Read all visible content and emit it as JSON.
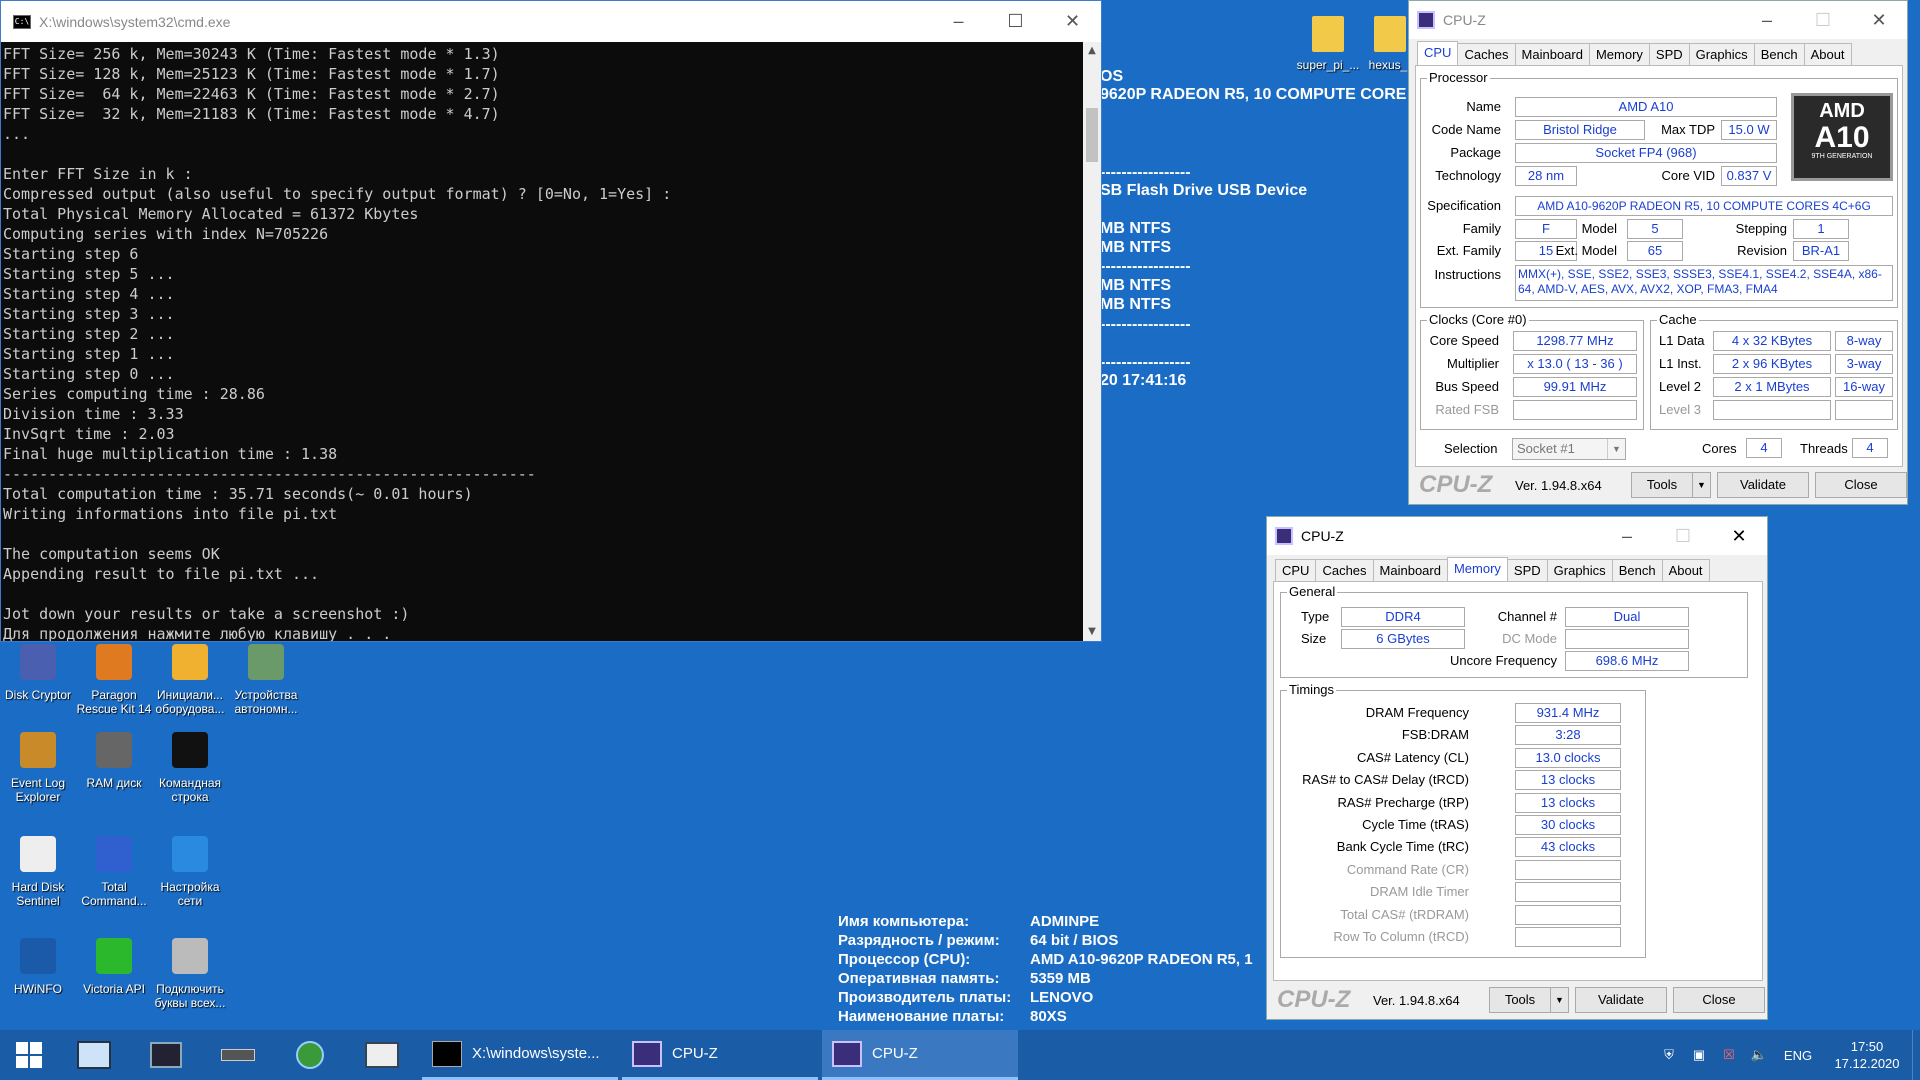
{
  "cmd": {
    "title": "X:\\windows\\system32\\cmd.exe",
    "icon": "cmd-icon",
    "lines": [
      "FFT Size= 256 k, Mem=30243 K (Time: Fastest mode * 1.3)",
      "FFT Size= 128 k, Mem=25123 K (Time: Fastest mode * 1.7)",
      "FFT Size=  64 k, Mem=22463 K (Time: Fastest mode * 2.7)",
      "FFT Size=  32 k, Mem=21183 K (Time: Fastest mode * 4.7)",
      "...",
      "",
      "Enter FFT Size in k :",
      "Compressed output (also useful to specify output format) ? [0=No, 1=Yes] :",
      "Total Physical Memory Allocated = 61372 Kbytes",
      "Computing series with index N=705226",
      "Starting step 6",
      "Starting step 5 ...",
      "Starting step 4 ...",
      "Starting step 3 ...",
      "Starting step 2 ...",
      "Starting step 1 ...",
      "Starting step 0 ...",
      "Series computing time : 28.86",
      "Division time : 3.33",
      "InvSqrt time : 2.03",
      "Final huge multiplication time : 1.38",
      "-----------------------------------------------------------",
      "Total computation time : 35.71 seconds(~ 0.01 hours)",
      "Writing informations into file pi.txt",
      "",
      "The computation seems OK",
      "Appending result to file pi.txt ...",
      "",
      "Jot down your results or take a screenshot :)",
      "Для продолжения нажмите любую клавишу . . ."
    ]
  },
  "bg": {
    "line1": "OS",
    "line2": "9620P RADEON R5, 10 COMPUTE CORE",
    "sep": "-----------------",
    "usb": "SB Flash Drive USB Device",
    "ntfs1": "MB NTFS",
    "ntfs2": "MB NTFS",
    "ntfs3": "MB NTFS",
    "ntfs4": "MB NTFS",
    "date": "20 17:41:16"
  },
  "sysinfo": {
    "labels": [
      "Имя компьютера:",
      "Разрядность / режим:",
      "Процессор (CPU):",
      "Оперативная память:",
      "Производитель платы:",
      "Наименование платы:"
    ],
    "values": [
      "ADMINPE",
      "64 bit / BIOS",
      "AMD A10-9620P RADEON R5, 1",
      "5359 MB",
      "LENOVO",
      "80XS"
    ]
  },
  "desktop": {
    "top_icons": [
      {
        "label": "super_pi_...",
        "icon": "folder-icon"
      },
      {
        "label": "hexus_",
        "icon": "folder-icon"
      }
    ],
    "icons": [
      {
        "label": "Disk Cryptor",
        "icon": "diskcryptor-icon"
      },
      {
        "label": "Paragon Rescue Kit 14",
        "icon": "paragon-icon"
      },
      {
        "label": "Инициали... оборудова...",
        "icon": "hardware-init-icon"
      },
      {
        "label": "Устройства автономн...",
        "icon": "offline-devices-icon"
      },
      {
        "label": "Event Log Explorer",
        "icon": "event-log-icon"
      },
      {
        "label": "RAM диск",
        "icon": "ram-disk-icon"
      },
      {
        "label": "Командная строка",
        "icon": "cmd-icon"
      },
      {
        "label": "Hard Disk Sentinel",
        "icon": "hdd-sentinel-icon"
      },
      {
        "label": "Total Command...",
        "icon": "total-commander-icon"
      },
      {
        "label": "Настройка сети",
        "icon": "network-settings-icon"
      },
      {
        "label": "HWiNFO",
        "icon": "hwinfo-icon"
      },
      {
        "label": "Victoria API",
        "icon": "victoria-icon"
      },
      {
        "label": "Подключить буквы всех...",
        "icon": "connect-drives-icon"
      }
    ]
  },
  "cpuz1": {
    "title": "CPU-Z",
    "tabs": [
      "CPU",
      "Caches",
      "Mainboard",
      "Memory",
      "SPD",
      "Graphics",
      "Bench",
      "About"
    ],
    "active": "CPU",
    "processor_label": "Processor",
    "name_label": "Name",
    "name": "AMD A10",
    "codename_label": "Code Name",
    "codename": "Bristol Ridge",
    "tdp_label": "Max TDP",
    "tdp": "15.0 W",
    "package_label": "Package",
    "package": "Socket FP4 (968)",
    "tech_label": "Technology",
    "tech": "28 nm",
    "vid_label": "Core VID",
    "vid": "0.837 V",
    "spec_label": "Specification",
    "spec": "AMD A10-9620P RADEON R5, 10 COMPUTE CORES 4C+6G",
    "family_label": "Family",
    "family": "F",
    "model_label": "Model",
    "model": "5",
    "stepping_label": "Stepping",
    "stepping": "1",
    "extfam_label": "Ext. Family",
    "extfam": "15",
    "extmodel_label": "Ext. Model",
    "extmodel": "65",
    "revision_label": "Revision",
    "revision": "BR-A1",
    "instr_label": "Instructions",
    "instr": "MMX(+), SSE, SSE2, SSE3, SSSE3, SSE4.1, SSE4.2, SSE4A, x86-64, AMD-V, AES, AVX, AVX2, XOP, FMA3, FMA4",
    "logo_brand": "AMD",
    "logo_model": "A10",
    "logo_sub": "9TH GENERATION",
    "clocks_label": "Clocks (Core #0)",
    "corespeed_label": "Core Speed",
    "corespeed": "1298.77 MHz",
    "mult_label": "Multiplier",
    "mult": "x 13.0 ( 13 - 36 )",
    "bus_label": "Bus Speed",
    "bus": "99.91 MHz",
    "fsb_label": "Rated FSB",
    "cache_label": "Cache",
    "l1d_label": "L1 Data",
    "l1d": "4 x 32 KBytes",
    "l1d_way": "8-way",
    "l1i_label": "L1 Inst.",
    "l1i": "2 x 96 KBytes",
    "l1i_way": "3-way",
    "l2_label": "Level 2",
    "l2": "2 x 1 MBytes",
    "l2_way": "16-way",
    "l3_label": "Level 3",
    "selection_label": "Selection",
    "selection": "Socket #1",
    "cores_label": "Cores",
    "cores": "4",
    "threads_label": "Threads",
    "threads": "4",
    "brand": "CPU-Z",
    "version": "Ver. 1.94.8.x64",
    "tools": "Tools",
    "validate": "Validate",
    "close": "Close"
  },
  "cpuz2": {
    "title": "CPU-Z",
    "tabs": [
      "CPU",
      "Caches",
      "Mainboard",
      "Memory",
      "SPD",
      "Graphics",
      "Bench",
      "About"
    ],
    "active": "Memory",
    "general_label": "General",
    "type_label": "Type",
    "type": "DDR4",
    "channel_label": "Channel #",
    "channel": "Dual",
    "size_label": "Size",
    "size": "6 GBytes",
    "dcmode_label": "DC Mode",
    "uncore_label": "Uncore Frequency",
    "uncore": "698.6 MHz",
    "timings_label": "Timings",
    "timings": [
      {
        "label": "DRAM Frequency",
        "value": "931.4 MHz",
        "dis": false
      },
      {
        "label": "FSB:DRAM",
        "value": "3:28",
        "dis": false
      },
      {
        "label": "CAS# Latency (CL)",
        "value": "13.0 clocks",
        "dis": false
      },
      {
        "label": "RAS# to CAS# Delay (tRCD)",
        "value": "13 clocks",
        "dis": false
      },
      {
        "label": "RAS# Precharge (tRP)",
        "value": "13 clocks",
        "dis": false
      },
      {
        "label": "Cycle Time (tRAS)",
        "value": "30 clocks",
        "dis": false
      },
      {
        "label": "Bank Cycle Time (tRC)",
        "value": "43 clocks",
        "dis": false
      },
      {
        "label": "Command Rate (CR)",
        "value": "",
        "dis": true
      },
      {
        "label": "DRAM Idle Timer",
        "value": "",
        "dis": true
      },
      {
        "label": "Total CAS# (tRDRAM)",
        "value": "",
        "dis": true
      },
      {
        "label": "Row To Column (tRCD)",
        "value": "",
        "dis": true
      }
    ],
    "brand": "CPU-Z",
    "version": "Ver. 1.94.8.x64",
    "tools": "Tools",
    "validate": "Validate",
    "close": "Close"
  },
  "taskbar": {
    "apps": [
      {
        "label": "X:\\windows\\syste...",
        "icon": "cmd-icon",
        "active": false
      },
      {
        "label": "CPU-Z",
        "icon": "cpuz-icon",
        "active": false
      },
      {
        "label": "CPU-Z",
        "icon": "cpuz-icon",
        "active": true
      }
    ],
    "lang": "ENG",
    "time": "17:50",
    "date": "17.12.2020"
  }
}
